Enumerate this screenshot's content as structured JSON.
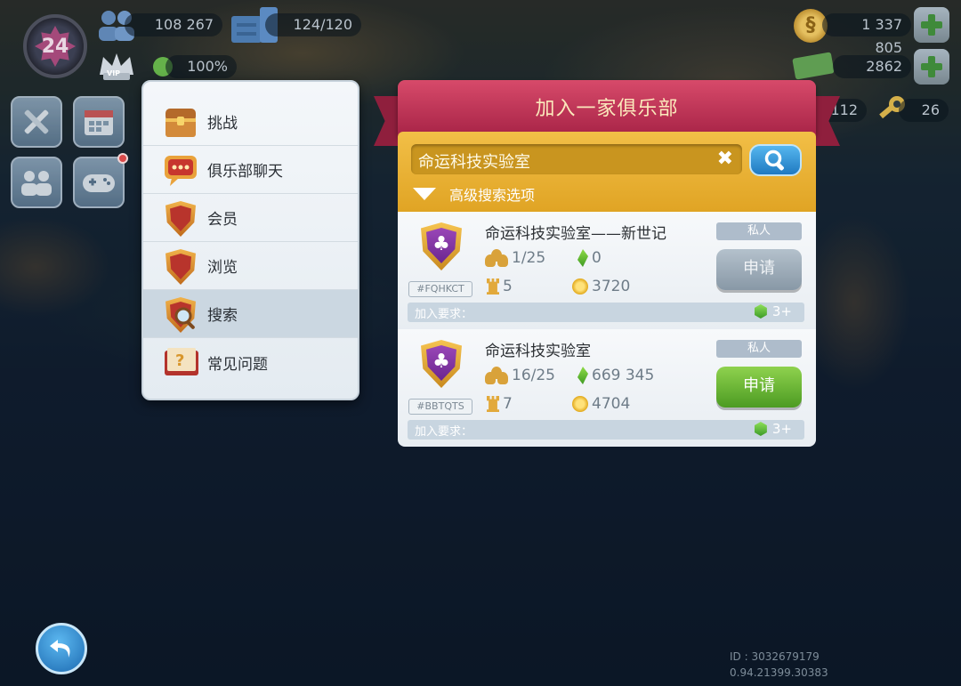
{
  "hud": {
    "level": "24",
    "population": "108 267",
    "storage": "124/120",
    "happiness": "100%",
    "vip_label": "VIP",
    "simoleons": "1 337 805",
    "simcash": "2862",
    "golden_keys": "112",
    "neo_keys": "26"
  },
  "menu": {
    "items": [
      {
        "label": "挑战",
        "icon": "chest-icon"
      },
      {
        "label": "俱乐部聊天",
        "icon": "chat-icon"
      },
      {
        "label": "会员",
        "icon": "members-shield-icon"
      },
      {
        "label": "浏览",
        "icon": "browse-shield-icon"
      },
      {
        "label": "搜索",
        "icon": "search-shield-icon"
      },
      {
        "label": "常见问题",
        "icon": "faq-book-icon"
      }
    ],
    "active_index": 4
  },
  "dialog": {
    "title": "加入一家俱乐部",
    "search_value": "命运科技实验室",
    "advanced_options": "高级搜索选项",
    "join_requirement_label": "加入要求：",
    "clubs": [
      {
        "name": "命运科技实验室——新世记",
        "tag": "#FQHKCT",
        "members": "1/25",
        "gems": "0",
        "towers": "5",
        "coins": "3720",
        "privacy": "私人",
        "apply": "申请",
        "apply_enabled": false,
        "requirement": "3+"
      },
      {
        "name": "命运科技实验室",
        "tag": "#BBTQTS",
        "members": "16/25",
        "gems": "669 345",
        "towers": "7",
        "coins": "4704",
        "privacy": "私人",
        "apply": "申请",
        "apply_enabled": true,
        "requirement": "3+"
      }
    ]
  },
  "footer": {
    "id": "ID : 3032679179",
    "version": "0.94.21399.30383"
  },
  "colors": {
    "banner": "#c1335a",
    "search_panel": "#eab138",
    "apply_enabled": "#6cb836",
    "apply_disabled": "#9aa9b6"
  }
}
